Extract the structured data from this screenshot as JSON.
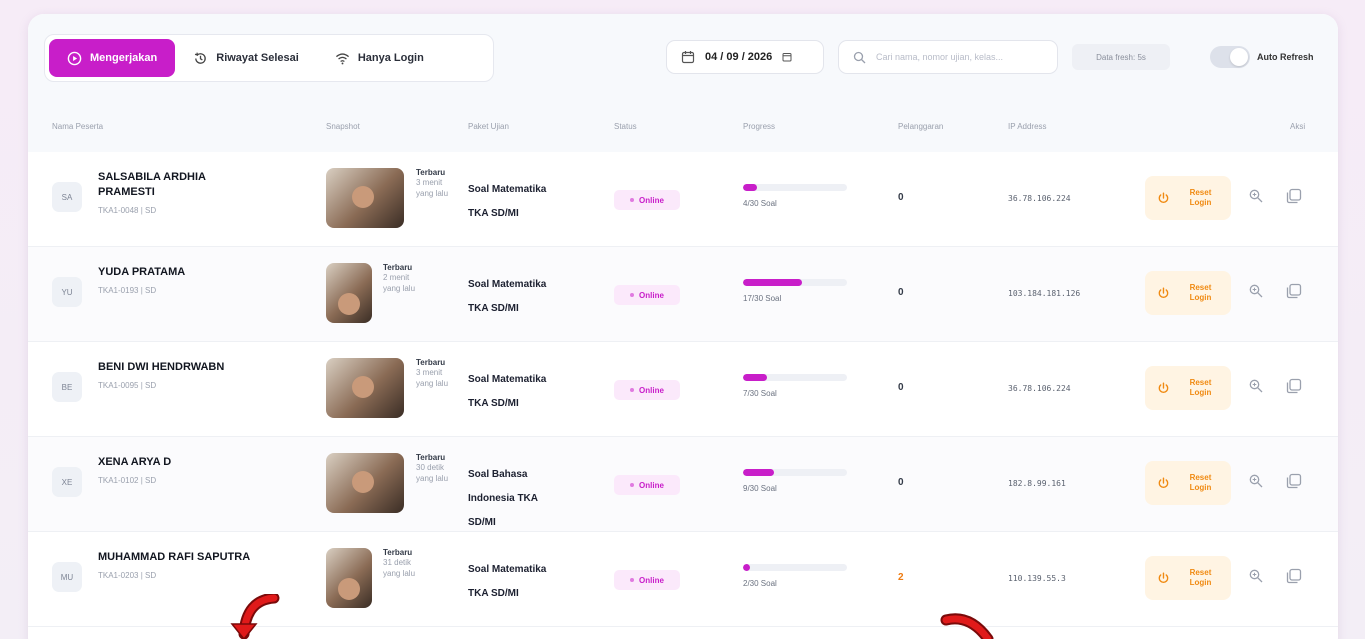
{
  "tabs": [
    {
      "label": "Mengerjakan",
      "icon": "play-circle-icon",
      "active": true
    },
    {
      "label": "Riwayat Selesai",
      "icon": "history-icon",
      "active": false
    },
    {
      "label": "Hanya Login",
      "icon": "wifi-icon",
      "active": false
    }
  ],
  "date": "04 / 09 / 2026",
  "search": {
    "placeholder": "Cari nama, nomor ujian, kelas...",
    "value": ""
  },
  "fresh": "Data fresh: 5s",
  "auto_refresh": "Auto Refresh",
  "columns": [
    "Nama Peserta",
    "Snapshot",
    "Paket Ujian",
    "Status",
    "Progress",
    "Pelanggaran",
    "IP Address",
    "Aksi"
  ],
  "rows": [
    {
      "initials": "SA",
      "name": "SALSABILA ARDHIA PRAMESTI",
      "id": "TKA1-0048 | SD",
      "snap_label": "Terbaru",
      "snap_time": "3 menit yang lalu",
      "paket": "Soal Matematika TKA SD/MI",
      "status": "Online",
      "progress": 0.13,
      "progress_text": "4/30 Soal",
      "violations": "0",
      "ip": "36.78.106.224"
    },
    {
      "initials": "YU",
      "name": "YUDA PRATAMA",
      "id": "TKA1-0193 | SD",
      "snap_label": "Terbaru",
      "snap_time": "2 menit yang lalu",
      "paket": "Soal Matematika TKA SD/MI",
      "status": "Online",
      "progress": 0.57,
      "progress_text": "17/30 Soal",
      "violations": "0",
      "ip": "103.184.181.126"
    },
    {
      "initials": "BE",
      "name": "BENI DWI HENDRWABN",
      "id": "TKA1-0095 | SD",
      "snap_label": "Terbaru",
      "snap_time": "3 menit yang lalu",
      "paket": "Soal Matematika TKA SD/MI",
      "status": "Online",
      "progress": 0.23,
      "progress_text": "7/30 Soal",
      "violations": "0",
      "ip": "36.78.106.224"
    },
    {
      "initials": "XE",
      "name": "XENA ARYA D",
      "id": "TKA1-0102 | SD",
      "snap_label": "Terbaru",
      "snap_time": "30 detik yang lalu",
      "paket": "Soal Bahasa Indonesia TKA SD/MI",
      "status": "Online",
      "progress": 0.3,
      "progress_text": "9/30 Soal",
      "violations": "0",
      "ip": "182.8.99.161"
    },
    {
      "initials": "MU",
      "name": "MUHAMMAD RAFI SAPUTRA",
      "id": "TKA1-0203 | SD",
      "snap_label": "Terbaru",
      "snap_time": "31 detik yang lalu",
      "paket": "Soal Matematika TKA SD/MI",
      "status": "Online",
      "progress": 0.07,
      "progress_text": "2/30 Soal",
      "violations": "2",
      "ip": "110.139.55.3"
    }
  ],
  "reset_label": "Reset Login",
  "colors": {
    "accent": "#c81ec9",
    "warn": "#f08a12",
    "arrow": "#e01a1a"
  }
}
